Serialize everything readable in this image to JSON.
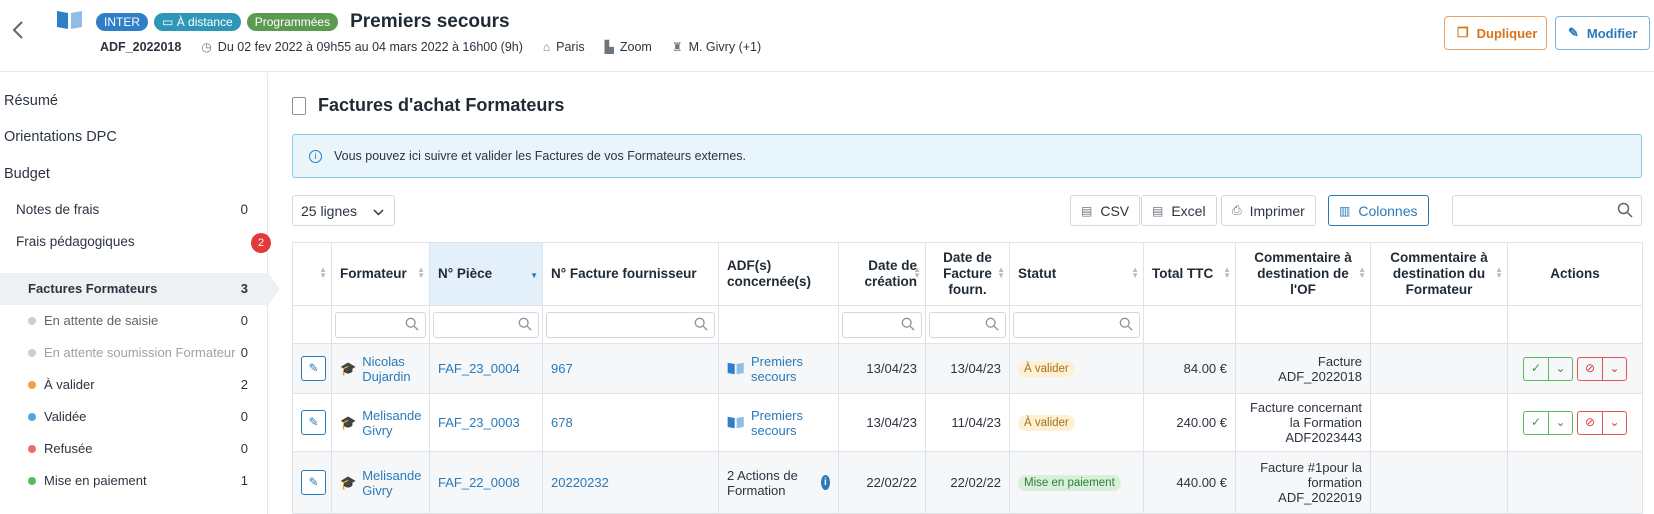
{
  "header": {
    "badges": [
      "INTER",
      "À distance",
      "Programmées"
    ],
    "title": "Premiers secours",
    "code": "ADF_2022018",
    "dates": "Du 02 fev 2022 à 09h55 au 04 mars 2022 à 16h00 (9h)",
    "location": "Paris",
    "platform": "Zoom",
    "trainer": "M. Givry (+1)",
    "duplicate_label": "Dupliquer",
    "edit_label": "Modifier"
  },
  "sidebar": {
    "resume": "Résumé",
    "orientations": "Orientations DPC",
    "budget": "Budget",
    "notes_frais": {
      "label": "Notes de frais",
      "count": "0"
    },
    "frais_peda": {
      "label": "Frais pédagogiques",
      "badge": "2"
    },
    "factures": {
      "label": "Factures Formateurs",
      "count": "3"
    },
    "statuses": [
      {
        "label": "En attente de saisie",
        "count": "0",
        "color": "#c9ced4"
      },
      {
        "label": "En attente soumission Formateur",
        "count": "0",
        "color": "#c9ced4"
      },
      {
        "label": "À valider",
        "count": "2",
        "color": "#f0a040"
      },
      {
        "label": "Validée",
        "count": "0",
        "color": "#5aa6dc"
      },
      {
        "label": "Refusée",
        "count": "0",
        "color": "#ec6a6a"
      },
      {
        "label": "Mise en paiement",
        "count": "1",
        "color": "#5cb85c"
      }
    ]
  },
  "main": {
    "section_title": "Factures d'achat Formateurs",
    "info": "Vous pouvez ici suivre et valider les Factures de vos Formateurs externes.",
    "rows_select": "25 lignes",
    "toolbar": {
      "csv": "CSV",
      "excel": "Excel",
      "print": "Imprimer",
      "columns": "Colonnes"
    },
    "columns": [
      "Formateur",
      "N° Pièce",
      "N° Facture fournisseur",
      "ADF(s) concernée(s)",
      "Date de création",
      "Date de Facture fourn.",
      "Statut",
      "Total TTC",
      "Commentaire à destination de l'OF",
      "Commentaire à destination du Formateur",
      "Actions"
    ],
    "rows": [
      {
        "formateur": "Nicolas Dujardin",
        "piece": "FAF_23_0004",
        "facture": "967",
        "adf": "Premiers secours",
        "creation": "13/04/23",
        "date_fourn": "13/04/23",
        "statut": "À valider",
        "total": "84.00 €",
        "comment_of": "Facture ADF_2022018",
        "comment_form": ""
      },
      {
        "formateur": "Melisande Givry",
        "piece": "FAF_23_0003",
        "facture": "678",
        "adf": "Premiers secours",
        "creation": "13/04/23",
        "date_fourn": "11/04/23",
        "statut": "À valider",
        "total": "240.00 €",
        "comment_of": "Facture concernant la Formation ADF2023443",
        "comment_form": ""
      },
      {
        "formateur": "Melisande Givry",
        "piece": "FAF_22_0008",
        "facture": "20220232",
        "adf": "2 Actions de Formation",
        "creation": "22/02/22",
        "date_fourn": "22/02/22",
        "statut": "Mise en paiement",
        "total": "440.00 €",
        "comment_of": "Facture #1pour la formation ADF_2022019",
        "comment_form": ""
      }
    ]
  }
}
